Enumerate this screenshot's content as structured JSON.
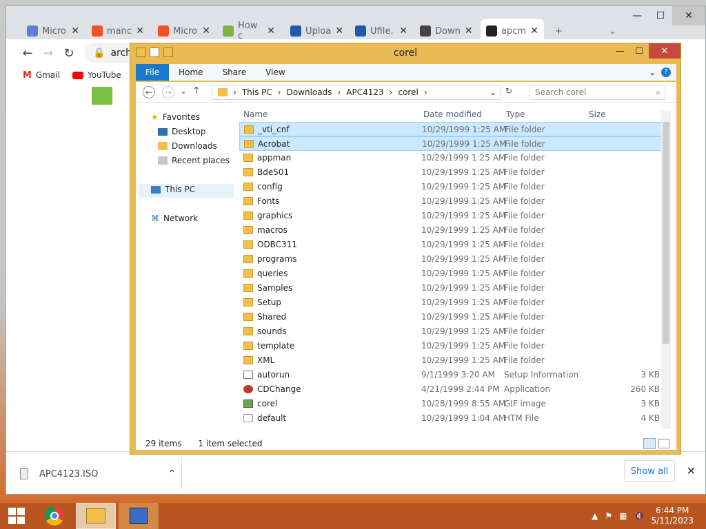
{
  "browser": {
    "tabs": [
      {
        "label": "Micro",
        "icon": "people-icon"
      },
      {
        "label": "manc",
        "icon": "windows-logo-icon"
      },
      {
        "label": "Micro",
        "icon": "windows-logo-icon"
      },
      {
        "label": "How c",
        "icon": "puzzle-icon"
      },
      {
        "label": "Uploa",
        "icon": "ufile-icon"
      },
      {
        "label": "Ufile.",
        "icon": "ufile-icon"
      },
      {
        "label": "Down",
        "icon": "download-icon"
      },
      {
        "label": "apcm",
        "icon": "archive-icon"
      }
    ],
    "new_tab": "+",
    "tab_dropdown": "⌄",
    "address_text": "archi",
    "bookmarks": [
      {
        "label": "Gmail",
        "icon": "gmail-icon"
      },
      {
        "label": "YouTube",
        "icon": "youtube-icon"
      }
    ],
    "download_item": "APC4123.ISO",
    "show_all": "Show all",
    "close": "✕"
  },
  "explorer": {
    "title": "corel",
    "ribbon": [
      "File",
      "Home",
      "Share",
      "View"
    ],
    "breadcrumb": [
      "This PC",
      "Downloads",
      "APC4123",
      "corel"
    ],
    "search_placeholder": "Search corel",
    "columns": {
      "name": "Name",
      "date": "Date modified",
      "type": "Type",
      "size": "Size"
    },
    "nav": {
      "favorites": "Favorites",
      "desktop": "Desktop",
      "downloads": "Downloads",
      "recent": "Recent places",
      "thispc": "This PC",
      "network": "Network"
    },
    "files": [
      {
        "name": "_vti_cnf",
        "date": "10/29/1999 1:25 AM",
        "type": "File folder",
        "size": "",
        "kind": "folder",
        "selected": true
      },
      {
        "name": "Acrobat",
        "date": "10/29/1999 1:25 AM",
        "type": "File folder",
        "size": "",
        "kind": "folder",
        "selected": true
      },
      {
        "name": "appman",
        "date": "10/29/1999 1:25 AM",
        "type": "File folder",
        "size": "",
        "kind": "folder"
      },
      {
        "name": "Bde501",
        "date": "10/29/1999 1:25 AM",
        "type": "File folder",
        "size": "",
        "kind": "folder"
      },
      {
        "name": "config",
        "date": "10/29/1999 1:25 AM",
        "type": "File folder",
        "size": "",
        "kind": "folder"
      },
      {
        "name": "Fonts",
        "date": "10/29/1999 1:25 AM",
        "type": "File folder",
        "size": "",
        "kind": "folder"
      },
      {
        "name": "graphics",
        "date": "10/29/1999 1:25 AM",
        "type": "File folder",
        "size": "",
        "kind": "folder"
      },
      {
        "name": "macros",
        "date": "10/29/1999 1:25 AM",
        "type": "File folder",
        "size": "",
        "kind": "folder"
      },
      {
        "name": "ODBC311",
        "date": "10/29/1999 1:25 AM",
        "type": "File folder",
        "size": "",
        "kind": "folder"
      },
      {
        "name": "programs",
        "date": "10/29/1999 1:25 AM",
        "type": "File folder",
        "size": "",
        "kind": "folder"
      },
      {
        "name": "queries",
        "date": "10/29/1999 1:25 AM",
        "type": "File folder",
        "size": "",
        "kind": "folder"
      },
      {
        "name": "Samples",
        "date": "10/29/1999 1:25 AM",
        "type": "File folder",
        "size": "",
        "kind": "folder"
      },
      {
        "name": "Setup",
        "date": "10/29/1999 1:25 AM",
        "type": "File folder",
        "size": "",
        "kind": "folder"
      },
      {
        "name": "Shared",
        "date": "10/29/1999 1:25 AM",
        "type": "File folder",
        "size": "",
        "kind": "folder"
      },
      {
        "name": "sounds",
        "date": "10/29/1999 1:25 AM",
        "type": "File folder",
        "size": "",
        "kind": "folder"
      },
      {
        "name": "template",
        "date": "10/29/1999 1:25 AM",
        "type": "File folder",
        "size": "",
        "kind": "folder"
      },
      {
        "name": "XML",
        "date": "10/29/1999 1:25 AM",
        "type": "File folder",
        "size": "",
        "kind": "folder"
      },
      {
        "name": "autorun",
        "date": "9/1/1999 3:20 AM",
        "type": "Setup Information",
        "size": "3 KB",
        "kind": "setup"
      },
      {
        "name": "CDChange",
        "date": "4/21/1999 2:44 PM",
        "type": "Application",
        "size": "260 KB",
        "kind": "app"
      },
      {
        "name": "corel",
        "date": "10/28/1999 8:55 AM",
        "type": "GIF image",
        "size": "3 KB",
        "kind": "image"
      },
      {
        "name": "default",
        "date": "10/29/1999 1:04 AM",
        "type": "HTM File",
        "size": "4 KB",
        "kind": "htm"
      }
    ],
    "status_items": "29 items",
    "status_selected": "1 item selected"
  },
  "taskbar": {
    "time": "6:44 PM",
    "date": "5/11/2023"
  },
  "colors": {
    "selection": "#cce8ff",
    "explorer_frame": "#e8bb55",
    "taskbar": "#b9561f",
    "file_tab": "#1979ca"
  }
}
